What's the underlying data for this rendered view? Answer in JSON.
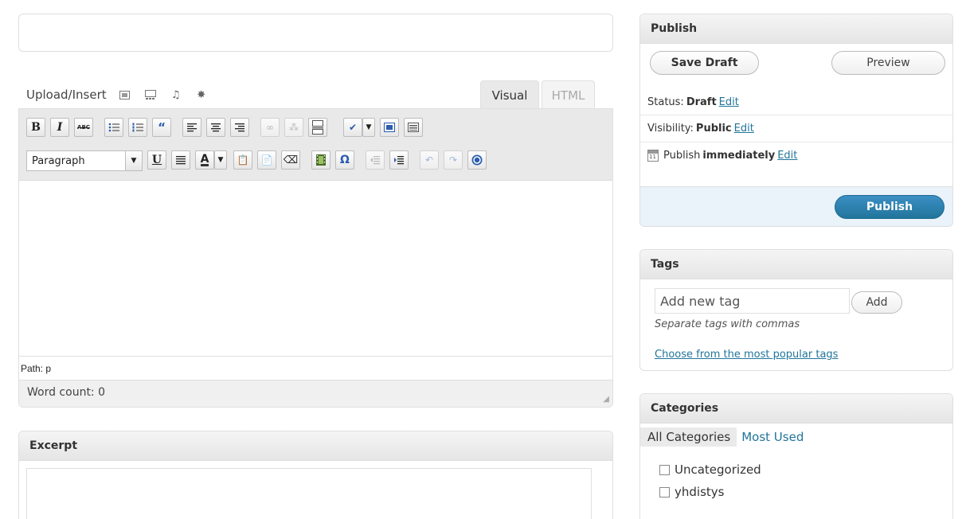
{
  "editor": {
    "upload_label": "Upload/Insert",
    "media_icons": [
      "image-icon",
      "gallery-icon",
      "audio-icon",
      "media-icon"
    ],
    "tabs": {
      "visual": "Visual",
      "html": "HTML"
    },
    "format_value": "Paragraph",
    "path_label": "Path: p",
    "word_count_label": "Word count: 0"
  },
  "excerpt": {
    "title": "Excerpt"
  },
  "publish": {
    "title": "Publish",
    "save_draft": "Save Draft",
    "preview": "Preview",
    "status_label": "Status:",
    "status_value": "Draft",
    "visibility_label": "Visibility:",
    "visibility_value": "Public",
    "schedule_label": "Publish",
    "schedule_value": "immediately",
    "edit_label": "Edit",
    "publish_button": "Publish"
  },
  "tags": {
    "title": "Tags",
    "input_placeholder": "Add new tag",
    "add_button": "Add",
    "hint": "Separate tags with commas",
    "popular_link": "Choose from the most popular tags"
  },
  "categories": {
    "title": "Categories",
    "tab_all": "All Categories",
    "tab_most_used": "Most Used",
    "items": [
      "Uncategorized",
      "yhdistys"
    ]
  },
  "colors": {
    "link": "#21759b",
    "publish_button": "#21759b",
    "footer_bg": "#eaf2fa"
  }
}
